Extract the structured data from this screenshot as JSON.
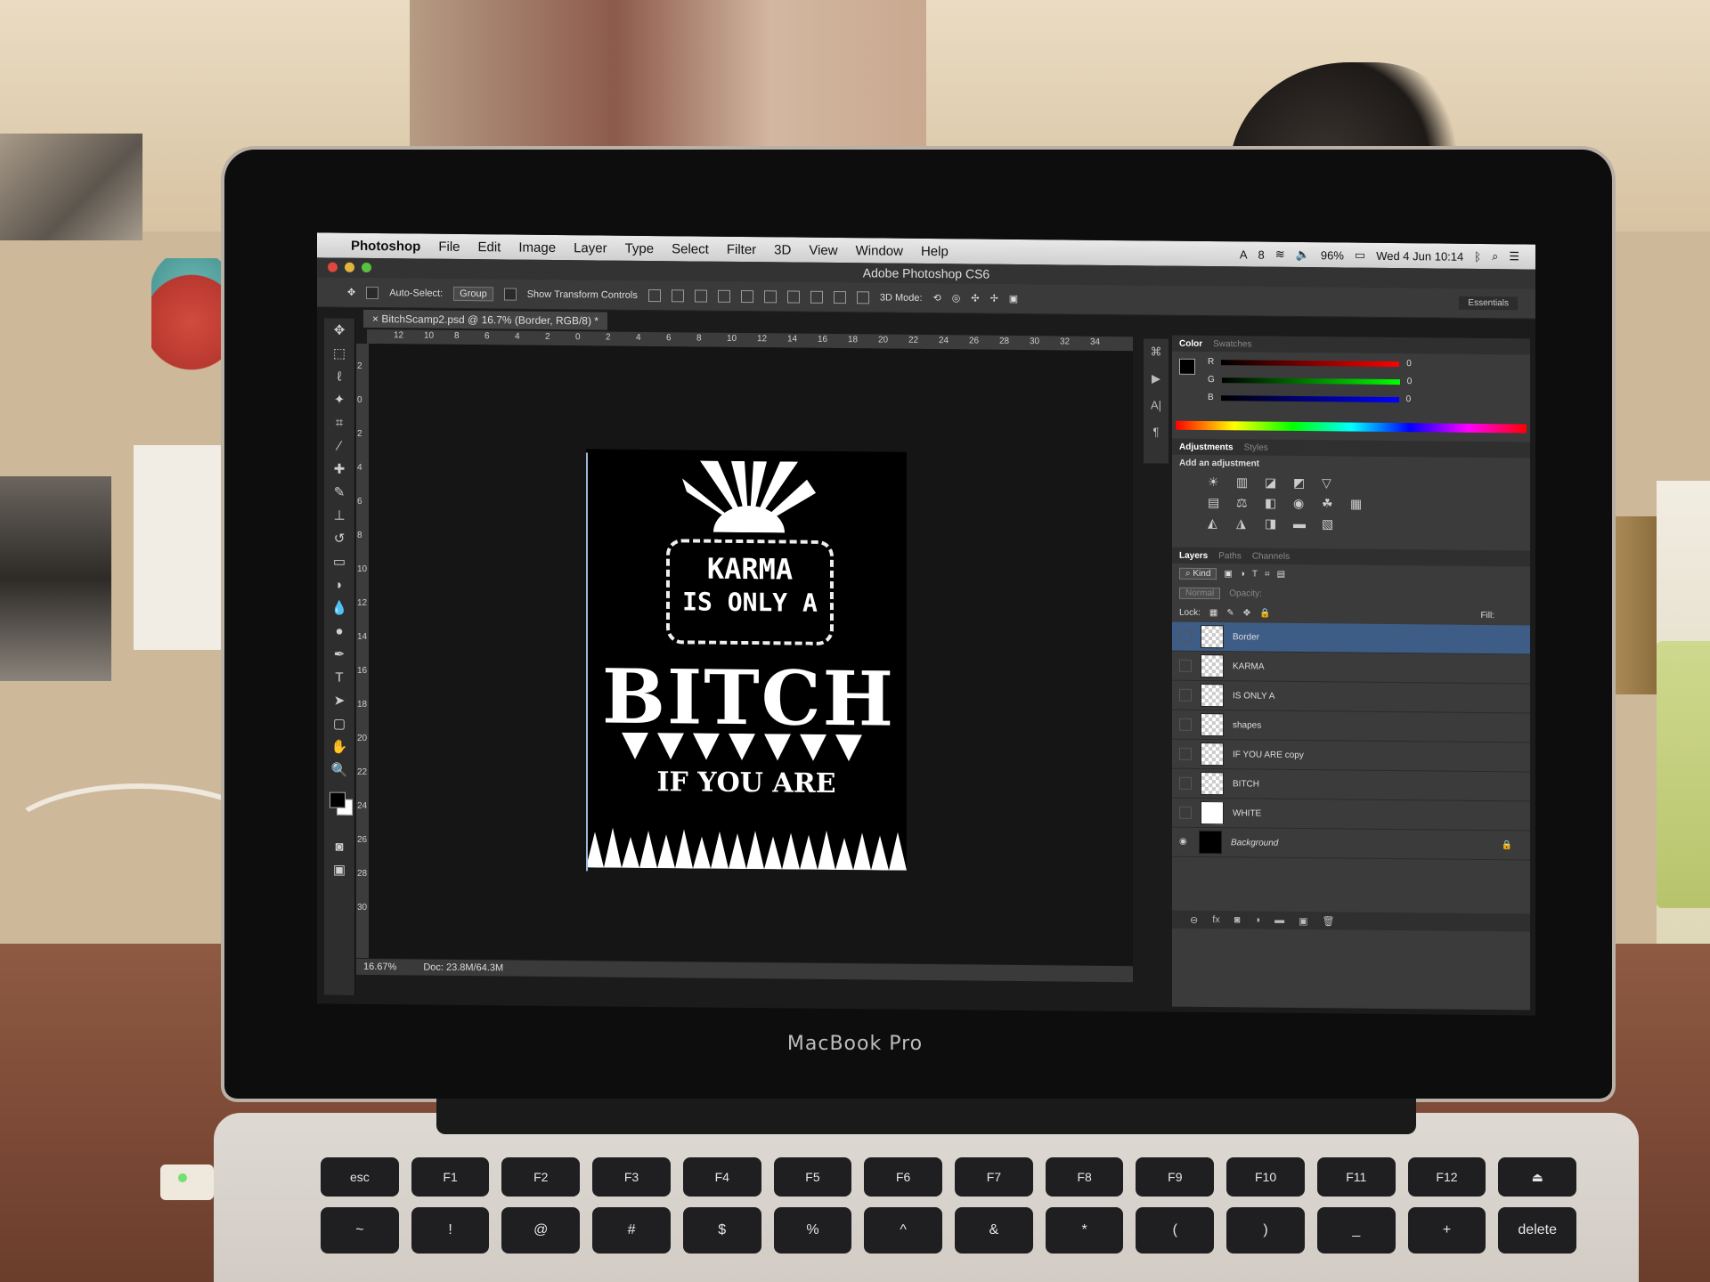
{
  "menubar": {
    "app_name": "Photoshop",
    "menus": [
      "File",
      "Edit",
      "Image",
      "Layer",
      "Type",
      "Select",
      "Filter",
      "3D",
      "View",
      "Window",
      "Help"
    ],
    "battery": "96%",
    "datetime": "Wed 4 Jun  10:14",
    "adobe_badge": "8"
  },
  "window": {
    "title": "Adobe Photoshop CS6"
  },
  "options_bar": {
    "auto_select_label": "Auto-Select:",
    "auto_select_value": "Group",
    "show_transform_label": "Show Transform Controls",
    "mode_3d_label": "3D Mode:",
    "workspace": "Essentials"
  },
  "document": {
    "tab_label": "BitchScamp2.psd @ 16.7% (Border, RGB/8) *",
    "zoom": "16.67%",
    "doc_size": "Doc: 23.8M/64.3M",
    "ruler_top": [
      "12",
      "10",
      "8",
      "6",
      "4",
      "2",
      "0",
      "2",
      "4",
      "6",
      "8",
      "10",
      "12",
      "14",
      "16",
      "18",
      "20",
      "22",
      "24",
      "26",
      "28",
      "30",
      "32",
      "34"
    ],
    "ruler_left": [
      "2",
      "0",
      "2",
      "4",
      "6",
      "8",
      "10",
      "12",
      "14",
      "16",
      "18",
      "20",
      "22",
      "24",
      "26",
      "28",
      "30"
    ]
  },
  "artwork": {
    "line1": "KARMA",
    "line2": "IS ONLY A",
    "big": "BITCH",
    "bottom": "IF YOU ARE"
  },
  "panels": {
    "color_tab": "Color",
    "swatches_tab": "Swatches",
    "r_label": "R",
    "g_label": "G",
    "b_label": "B",
    "r_value": "0",
    "g_value": "0",
    "b_value": "0",
    "adjustments_tab": "Adjustments",
    "styles_tab": "Styles",
    "add_adjustment": "Add an adjustment",
    "layers_tab": "Layers",
    "paths_tab": "Paths",
    "channels_tab": "Channels",
    "kind_label": "Kind",
    "blend_mode": "Normal",
    "opacity_label": "Opacity:",
    "lock_label": "Lock:",
    "fill_label": "Fill:",
    "layers": [
      {
        "name": "Border"
      },
      {
        "name": "KARMA"
      },
      {
        "name": "IS ONLY A"
      },
      {
        "name": "shapes"
      },
      {
        "name": "IF YOU ARE copy"
      },
      {
        "name": "BITCH"
      },
      {
        "name": "WHITE"
      },
      {
        "name": "Background"
      }
    ]
  },
  "laptop": {
    "brand": "MacBook Pro"
  },
  "keyboard": {
    "fn_row": [
      "esc",
      "F1",
      "F2",
      "F3",
      "F4",
      "F5",
      "F6",
      "F7",
      "F8",
      "F9",
      "F10",
      "F11",
      "F12",
      "⏏"
    ],
    "num_row": [
      "~",
      "!",
      "@",
      "#",
      "$",
      "%",
      "^",
      "&",
      "*",
      "(",
      ")",
      "_",
      "+",
      "delete"
    ]
  },
  "colors": {
    "selected_layer": "#3e5d86",
    "panel_bg": "#3b3b3b",
    "menubar_bg": "#e1e1e1"
  }
}
